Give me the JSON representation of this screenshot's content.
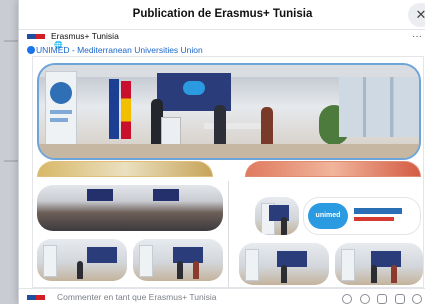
{
  "dialog": {
    "title": "Publication de Erasmus+ Tunisia",
    "close_symbol": "✕"
  },
  "post": {
    "author": "Erasmus+ Tunisia",
    "visibility_icon": "globe-icon",
    "visibility_symbol": "🌐",
    "more_symbol": "···",
    "mention": "UNIMED - Mediterranean Universities Union"
  },
  "gallery": {
    "logo_text": "unimed"
  },
  "composer": {
    "placeholder": "Commenter en tant que Erasmus+ Tunisia",
    "icons": [
      "emoji-icon",
      "sticker-icon",
      "camera-icon",
      "gif-icon",
      "more-sticker-icon"
    ]
  },
  "colors": {
    "accent": "#1a66c9",
    "flag_blue": "#1d4fa3",
    "flag_red": "#d21f26"
  }
}
